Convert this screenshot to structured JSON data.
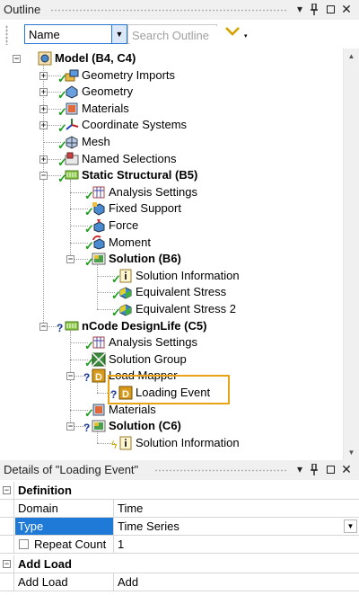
{
  "outline": {
    "title": "Outline",
    "pin_icon": "pin-icon",
    "toolbar": {
      "combo_value": "Name",
      "search_placeholder": "Search Outline"
    },
    "nodes": [
      {
        "id": "model",
        "label": "Model (B4, C4)",
        "bold": true,
        "icon": "model-icon"
      },
      {
        "id": "geometry-imports",
        "label": "Geometry Imports",
        "icon": "geometry-imports-icon",
        "status": "check"
      },
      {
        "id": "geometry",
        "label": "Geometry",
        "icon": "geometry-icon",
        "status": "check"
      },
      {
        "id": "materials",
        "label": "Materials",
        "icon": "materials-icon",
        "status": "check"
      },
      {
        "id": "coordinate-systems",
        "label": "Coordinate Systems",
        "icon": "coordinate-systems-icon",
        "status": "check"
      },
      {
        "id": "mesh",
        "label": "Mesh",
        "icon": "mesh-icon",
        "status": "check"
      },
      {
        "id": "named-selections",
        "label": "Named Selections",
        "icon": "named-selections-icon",
        "status": "check"
      },
      {
        "id": "static-structural",
        "label": "Static Structural (B5)",
        "bold": true,
        "icon": "static-structural-icon",
        "status": "check"
      },
      {
        "id": "analysis-settings-b5",
        "label": "Analysis Settings",
        "icon": "analysis-settings-icon",
        "status": "check"
      },
      {
        "id": "fixed-support",
        "label": "Fixed Support",
        "icon": "fixed-support-icon",
        "status": "check"
      },
      {
        "id": "force",
        "label": "Force",
        "icon": "force-icon",
        "status": "check"
      },
      {
        "id": "moment",
        "label": "Moment",
        "icon": "moment-icon",
        "status": "check"
      },
      {
        "id": "solution-b6",
        "label": "Solution (B6)",
        "bold": true,
        "icon": "solution-icon",
        "status": "check"
      },
      {
        "id": "solution-information-b6",
        "label": "Solution Information",
        "icon": "solution-information-icon",
        "status": "check"
      },
      {
        "id": "equivalent-stress",
        "label": "Equivalent Stress",
        "icon": "equivalent-stress-icon",
        "status": "check"
      },
      {
        "id": "equivalent-stress-2",
        "label": "Equivalent Stress 2",
        "icon": "equivalent-stress-icon",
        "status": "check"
      },
      {
        "id": "ncode-designlife",
        "label": "nCode DesignLife (C5)",
        "bold": true,
        "icon": "ncode-designlife-icon",
        "status": "question"
      },
      {
        "id": "analysis-settings-c5",
        "label": "Analysis Settings",
        "icon": "analysis-settings-icon",
        "status": "check"
      },
      {
        "id": "solution-group",
        "label": "Solution Group",
        "icon": "solution-group-icon",
        "status": "check"
      },
      {
        "id": "load-mapper",
        "label": "Load Mapper",
        "icon": "load-mapper-icon",
        "status": "question"
      },
      {
        "id": "loading-event",
        "label": "Loading Event",
        "icon": "loading-event-icon",
        "status": "question"
      },
      {
        "id": "materials-c5",
        "label": "Materials",
        "icon": "materials-icon",
        "status": "check"
      },
      {
        "id": "solution-c6",
        "label": "Solution (C6)",
        "bold": true,
        "icon": "solution-icon",
        "status": "question"
      },
      {
        "id": "solution-information-c6",
        "label": "Solution Information",
        "icon": "solution-information-icon",
        "status": "lightning"
      }
    ]
  },
  "details": {
    "title": "Details of \"Loading Event\"",
    "sections": [
      {
        "label": "Definition",
        "rows": [
          {
            "name": "Domain",
            "value": "Time"
          },
          {
            "name": "Type",
            "value": "Time Series",
            "selected": true,
            "dropdown": true
          },
          {
            "name": "Repeat Count",
            "value": "1",
            "checkbox": true
          }
        ]
      },
      {
        "label": "Add Load",
        "rows": [
          {
            "name": "Add Load",
            "value": "Add"
          }
        ]
      }
    ]
  },
  "colors": {
    "check": "#1f9d1f",
    "question": "#1a3a9a",
    "highlight": "#e8a317",
    "selection": "#1e7ad6"
  }
}
